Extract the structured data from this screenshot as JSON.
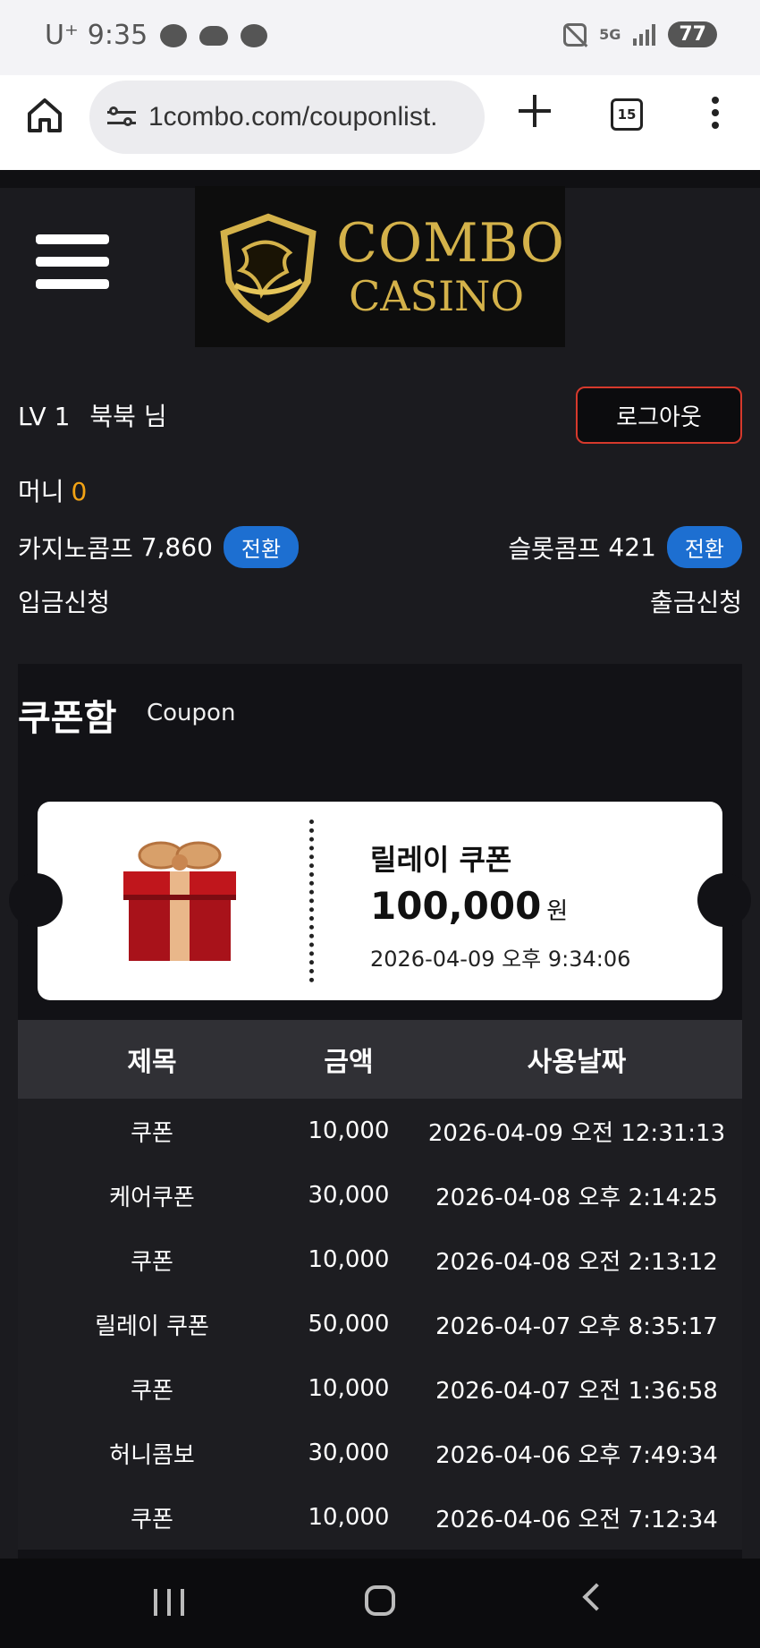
{
  "status_bar": {
    "carrier": "U⁺",
    "time": "9:35",
    "network": "5G",
    "battery": "77"
  },
  "browser": {
    "url": "1combo.com/couponlist.",
    "tab_count": "15"
  },
  "header": {
    "logo_line1": "COMBO",
    "logo_line2": "CASINO"
  },
  "account": {
    "level": "LV 1",
    "username": "북북 님",
    "logout_label": "로그아웃",
    "money_label": "머니",
    "money_value": "0",
    "casino_comp_label": "카지노콤프",
    "casino_comp_value": "7,860",
    "slot_comp_label": "슬롯콤프",
    "slot_comp_value": "421",
    "swap_label": "전환",
    "deposit_label": "입금신청",
    "withdraw_label": "출금신청"
  },
  "coupon": {
    "title": "쿠폰함",
    "subtitle": "Coupon",
    "card": {
      "name": "릴레이 쿠폰",
      "amount": "100,000",
      "unit": "원",
      "date": "2026-04-09 오후 9:34:06"
    },
    "table": {
      "headers": [
        "제목",
        "금액",
        "사용날짜"
      ],
      "rows": [
        {
          "title": "쿠폰",
          "amount": "10,000",
          "date": "2026-04-09 오전 12:31:13"
        },
        {
          "title": "케어쿠폰",
          "amount": "30,000",
          "date": "2026-04-08 오후 2:14:25"
        },
        {
          "title": "쿠폰",
          "amount": "10,000",
          "date": "2026-04-08 오전 2:13:12"
        },
        {
          "title": "릴레이 쿠폰",
          "amount": "50,000",
          "date": "2026-04-07 오후 8:35:17"
        },
        {
          "title": "쿠폰",
          "amount": "10,000",
          "date": "2026-04-07 오전 1:36:58"
        },
        {
          "title": "허니콤보",
          "amount": "30,000",
          "date": "2026-04-06 오후 7:49:34"
        },
        {
          "title": "쿠폰",
          "amount": "10,000",
          "date": "2026-04-06 오전 7:12:34"
        }
      ]
    }
  },
  "colors": {
    "money_accent": "#f2a314",
    "swap_button": "#1d6fd1",
    "logout_border": "#d6392c",
    "logo_gold": "#d4b24a"
  }
}
